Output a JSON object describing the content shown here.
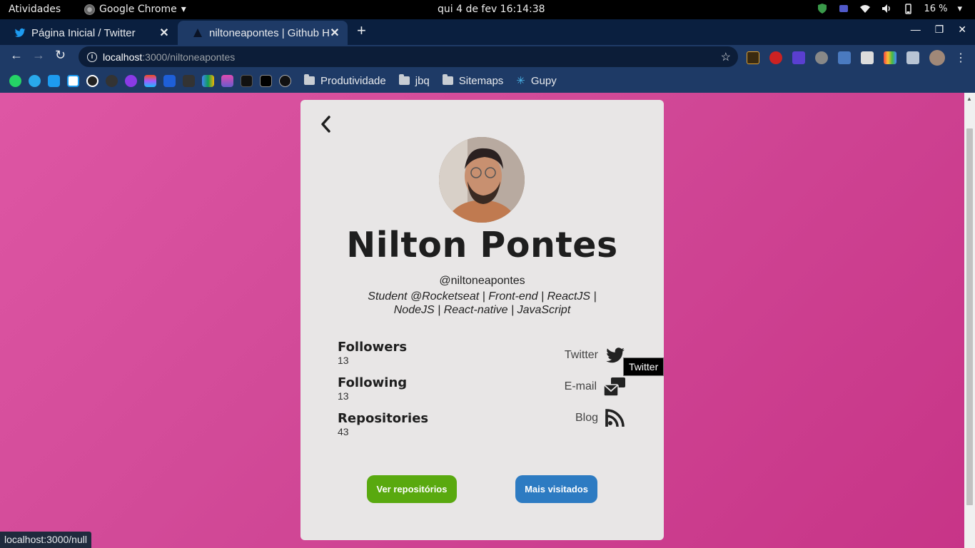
{
  "system_bar": {
    "activities": "Atividades",
    "app_name": "Google Chrome",
    "clock": "qui 4 de fev  16:14:38",
    "battery": "16 %"
  },
  "tabs": [
    {
      "title": "Página Inicial / Twitter",
      "icon": "twitter-icon"
    },
    {
      "title": "niltoneapontes | Github H",
      "icon": "triangle-icon"
    }
  ],
  "address_bar": {
    "host": "localhost",
    "path": ":3000/niltoneapontes"
  },
  "bookmarks": [
    {
      "label": "Produtividade"
    },
    {
      "label": "jbq"
    },
    {
      "label": "Sitemaps"
    },
    {
      "label": "Gupy"
    }
  ],
  "profile": {
    "name": "Nilton Pontes",
    "login": "@niltoneapontes",
    "bio": "Student @Rocketseat | Front-end | ReactJS | NodeJS | React-native | JavaScript"
  },
  "stats": [
    {
      "label": "Followers",
      "value": "13"
    },
    {
      "label": "Following",
      "value": "13"
    },
    {
      "label": "Repositories",
      "value": "43"
    }
  ],
  "links": [
    {
      "label": "Twitter",
      "icon": "twitter-icon"
    },
    {
      "label": "E-mail",
      "icon": "mail-icon"
    },
    {
      "label": "Blog",
      "icon": "rss-icon"
    }
  ],
  "tooltip": "Twitter",
  "buttons": {
    "repos": "Ver repositórios",
    "visited": "Mais visitados"
  },
  "status_url": "localhost:3000/null",
  "colors": {
    "background_pink": "#d24a98",
    "card": "#e8e6e6",
    "repos_button": "#59a90f",
    "visited_button": "#2d7bc2"
  }
}
